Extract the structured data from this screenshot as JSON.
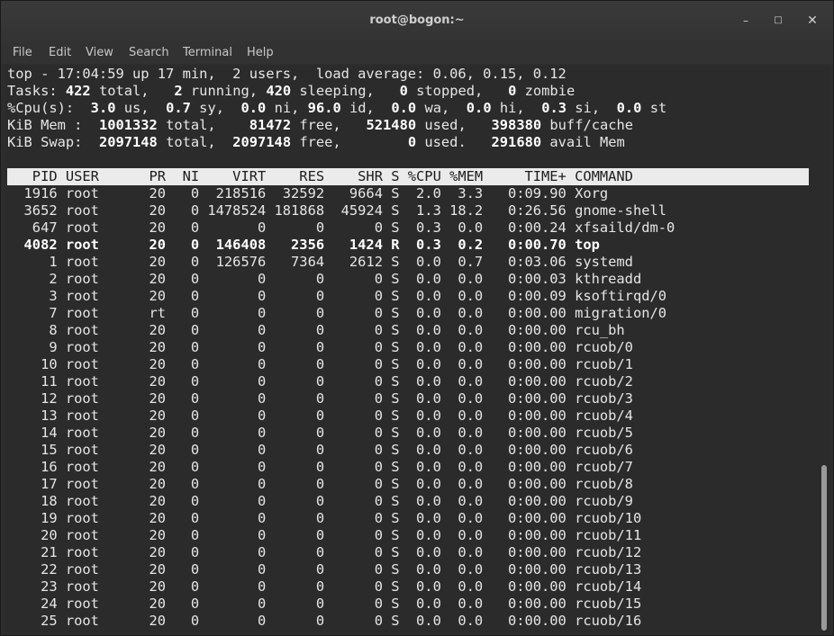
{
  "window": {
    "title": "root@bogon:~",
    "min_glyph": "–",
    "max_glyph": "□",
    "close_glyph": "✕"
  },
  "menu": [
    "File",
    "Edit",
    "View",
    "Search",
    "Terminal",
    "Help"
  ],
  "summary": {
    "uptime": "top - 17:04:59 up 17 min,  2 users,  load average: 0.06, 0.15, 0.12",
    "tasks": [
      "Tasks: ",
      "422",
      " total,   ",
      "2",
      " running, ",
      "420",
      " sleeping,   ",
      "0",
      " stopped,   ",
      "0",
      " zombie"
    ],
    "cpu": [
      "%Cpu(s):  ",
      "3.0",
      " us,  ",
      "0.7",
      " sy,  ",
      "0.0",
      " ni, ",
      "96.0",
      " id,  ",
      "0.0",
      " wa,  ",
      "0.0",
      " hi,  ",
      "0.3",
      " si,  ",
      "0.0",
      " st"
    ],
    "mem": [
      "KiB Mem :  ",
      "1001332",
      " total,    ",
      "81472",
      " free,   ",
      "521480",
      " used,   ",
      "398380",
      " buff/cache"
    ],
    "swap": [
      "KiB Swap:  ",
      "2097148",
      " total,  ",
      "2097148",
      " free,        ",
      "0",
      " used.   ",
      "291680",
      " avail Mem"
    ]
  },
  "table": {
    "header": "   PID USER      PR  NI    VIRT    RES    SHR S %CPU %MEM     TIME+ COMMAND",
    "rows": [
      {
        "text": "  1916 root      20   0  218516  32592   9664 S  2.0  3.3   0:09.90 Xorg",
        "bold": false
      },
      {
        "text": "  3652 root      20   0 1478524 181868  45924 S  1.3 18.2   0:26.56 gnome-shell",
        "bold": false
      },
      {
        "text": "   647 root      20   0       0      0      0 S  0.3  0.0   0:00.24 xfsaild/dm-0",
        "bold": false
      },
      {
        "text": "  4082 root      20   0  146408   2356   1424 R  0.3  0.2   0:00.70 top",
        "bold": true
      },
      {
        "text": "     1 root      20   0  126576   7364   2612 S  0.0  0.7   0:03.06 systemd",
        "bold": false
      },
      {
        "text": "     2 root      20   0       0      0      0 S  0.0  0.0   0:00.03 kthreadd",
        "bold": false
      },
      {
        "text": "     3 root      20   0       0      0      0 S  0.0  0.0   0:00.09 ksoftirqd/0",
        "bold": false
      },
      {
        "text": "     7 root      rt   0       0      0      0 S  0.0  0.0   0:00.00 migration/0",
        "bold": false
      },
      {
        "text": "     8 root      20   0       0      0      0 S  0.0  0.0   0:00.00 rcu_bh",
        "bold": false
      },
      {
        "text": "     9 root      20   0       0      0      0 S  0.0  0.0   0:00.00 rcuob/0",
        "bold": false
      },
      {
        "text": "    10 root      20   0       0      0      0 S  0.0  0.0   0:00.00 rcuob/1",
        "bold": false
      },
      {
        "text": "    11 root      20   0       0      0      0 S  0.0  0.0   0:00.00 rcuob/2",
        "bold": false
      },
      {
        "text": "    12 root      20   0       0      0      0 S  0.0  0.0   0:00.00 rcuob/3",
        "bold": false
      },
      {
        "text": "    13 root      20   0       0      0      0 S  0.0  0.0   0:00.00 rcuob/4",
        "bold": false
      },
      {
        "text": "    14 root      20   0       0      0      0 S  0.0  0.0   0:00.00 rcuob/5",
        "bold": false
      },
      {
        "text": "    15 root      20   0       0      0      0 S  0.0  0.0   0:00.00 rcuob/6",
        "bold": false
      },
      {
        "text": "    16 root      20   0       0      0      0 S  0.0  0.0   0:00.00 rcuob/7",
        "bold": false
      },
      {
        "text": "    17 root      20   0       0      0      0 S  0.0  0.0   0:00.00 rcuob/8",
        "bold": false
      },
      {
        "text": "    18 root      20   0       0      0      0 S  0.0  0.0   0:00.00 rcuob/9",
        "bold": false
      },
      {
        "text": "    19 root      20   0       0      0      0 S  0.0  0.0   0:00.00 rcuob/10",
        "bold": false
      },
      {
        "text": "    20 root      20   0       0      0      0 S  0.0  0.0   0:00.00 rcuob/11",
        "bold": false
      },
      {
        "text": "    21 root      20   0       0      0      0 S  0.0  0.0   0:00.00 rcuob/12",
        "bold": false
      },
      {
        "text": "    22 root      20   0       0      0      0 S  0.0  0.0   0:00.00 rcuob/13",
        "bold": false
      },
      {
        "text": "    23 root      20   0       0      0      0 S  0.0  0.0   0:00.00 rcuob/14",
        "bold": false
      },
      {
        "text": "    24 root      20   0       0      0      0 S  0.0  0.0   0:00.00 rcuob/15",
        "bold": false
      },
      {
        "text": "    25 root      20   0       0      0      0 S  0.0  0.0   0:00.00 rcuob/16",
        "bold": false
      }
    ]
  },
  "colors": {
    "background": "#2b2b2b",
    "foreground": "#e6e6e6",
    "header_bg": "#ebebeb"
  }
}
